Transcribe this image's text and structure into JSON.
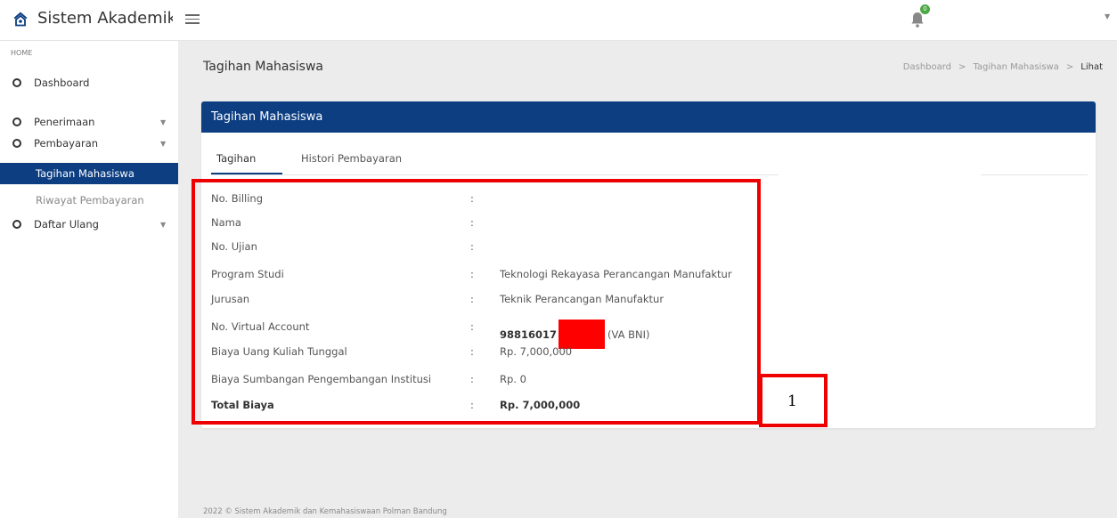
{
  "app": {
    "title": "Sistem Akademik"
  },
  "notifications": {
    "count": "0"
  },
  "sidebar": {
    "section": "HOME",
    "dashboard": "Dashboard",
    "penerimaan": "Penerimaan",
    "pembayaran": "Pembayaran",
    "tagihan": "Tagihan Mahasiswa",
    "riwayat": "Riwayat Pembayaran",
    "daftar_ulang": "Daftar Ulang"
  },
  "page": {
    "title": "Tagihan Mahasiswa"
  },
  "breadcrumb": {
    "items": [
      "Dashboard",
      "Tagihan Mahasiswa",
      "Lihat"
    ],
    "sep": ">"
  },
  "card": {
    "header": "Tagihan Mahasiswa",
    "tabs": [
      "Tagihan",
      "Histori Pembayaran"
    ]
  },
  "billing": {
    "rows": [
      {
        "label": "No. Billing",
        "value": ""
      },
      {
        "label": "Nama",
        "value": ""
      },
      {
        "label": "No. Ujian",
        "value": ""
      },
      {
        "label": "Program Studi",
        "value": "Teknologi Rekayasa Perancangan Manufaktur"
      },
      {
        "label": "Jurusan",
        "value": "Teknik Perancangan Manufaktur"
      },
      {
        "label": "No. Virtual Account",
        "value": "98816017",
        "suffix": "(VA BNI)"
      },
      {
        "label": "Biaya Uang Kuliah Tunggal",
        "value": "Rp. 7,000,000"
      },
      {
        "label": "Biaya Sumbangan Pengembangan Institusi",
        "value": "Rp. 0"
      },
      {
        "label": "Total Biaya",
        "value": "Rp. 7,000,000"
      }
    ],
    "colon": ":"
  },
  "annotation": {
    "number": "1"
  },
  "footer": {
    "text": "2022 © Sistem Akademik dan Kemahasiswaan Polman Bandung"
  },
  "colors": {
    "primary": "#0d3e82",
    "annotation": "#ee0000",
    "badge": "#49a842"
  }
}
